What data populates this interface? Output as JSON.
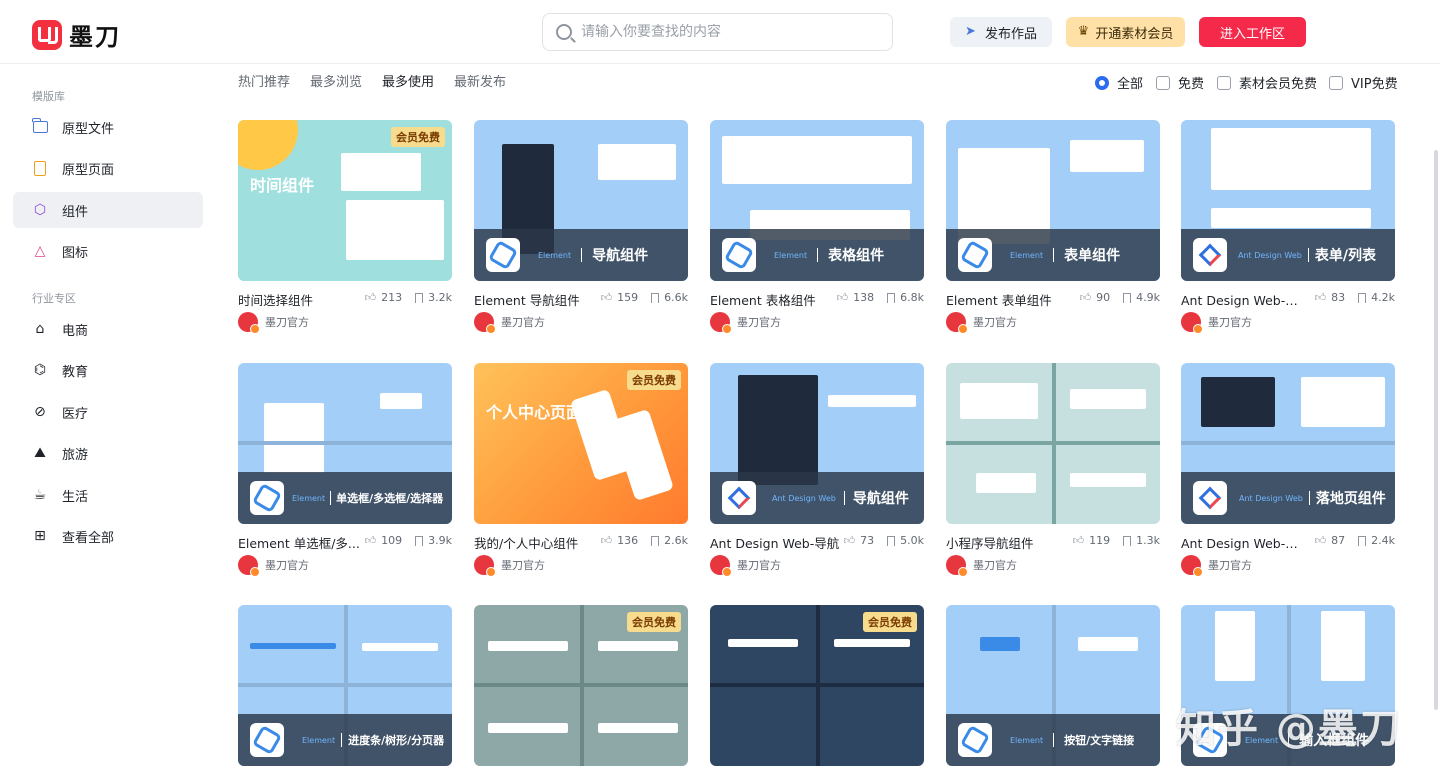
{
  "header": {
    "logo_text": "墨刀",
    "search_placeholder": "请输入你要查找的内容",
    "publish_label": "发布作品",
    "member_label": "开通素材会员",
    "workspace_label": "进入工作区"
  },
  "sidebar": {
    "section1": "模版库",
    "items1": [
      {
        "label": "原型文件",
        "icon": "folder-icon"
      },
      {
        "label": "原型页面",
        "icon": "file-icon"
      },
      {
        "label": "组件",
        "icon": "cube-icon"
      },
      {
        "label": "图标",
        "icon": "shapes-icon"
      }
    ],
    "section2": "行业专区",
    "items2": [
      {
        "label": "电商",
        "icon": "bag-icon"
      },
      {
        "label": "教育",
        "icon": "grad-cap-icon"
      },
      {
        "label": "医疗",
        "icon": "pill-icon"
      },
      {
        "label": "旅游",
        "icon": "mountain-icon"
      },
      {
        "label": "生活",
        "icon": "cup-icon"
      },
      {
        "label": "查看全部",
        "icon": "grid-icon"
      }
    ]
  },
  "tabs": [
    "热门推荐",
    "最多浏览",
    "最多使用",
    "最新发布"
  ],
  "filters": [
    "全部",
    "免费",
    "素材会员免费",
    "VIP免费"
  ],
  "member_badge": "会员免费",
  "author": "墨刀官方",
  "cards": [
    {
      "title": "时间选择组件",
      "likes": "213",
      "saves": "3.2k",
      "brand": "",
      "thumb_title": "时间组件"
    },
    {
      "title": "Element 导航组件",
      "likes": "159",
      "saves": "6.6k",
      "brand": "Element",
      "thumb_title": "导航组件"
    },
    {
      "title": "Element 表格组件",
      "likes": "138",
      "saves": "6.8k",
      "brand": "Element",
      "thumb_title": "表格组件"
    },
    {
      "title": "Element 表单组件",
      "likes": "90",
      "saves": "4.9k",
      "brand": "Element",
      "thumb_title": "表单组件"
    },
    {
      "title": "Ant Design Web-表...",
      "likes": "83",
      "saves": "4.2k",
      "brand": "Ant Design Web",
      "thumb_title": "表单/列表"
    },
    {
      "title": "Element 单选框/多...",
      "likes": "109",
      "saves": "3.9k",
      "brand": "Element",
      "thumb_title": "单选框/多选框/选择器"
    },
    {
      "title": "我的/个人中心组件",
      "likes": "136",
      "saves": "2.6k",
      "brand": "",
      "thumb_title": "个人中心页面"
    },
    {
      "title": "Ant Design Web-导航",
      "likes": "73",
      "saves": "5.0k",
      "brand": "Ant Design Web",
      "thumb_title": "导航组件"
    },
    {
      "title": "小程序导航组件",
      "likes": "119",
      "saves": "1.3k",
      "brand": "",
      "thumb_title": ""
    },
    {
      "title": "Ant Design Web-落...",
      "likes": "87",
      "saves": "2.4k",
      "brand": "Ant Design Web",
      "thumb_title": "落地页组件"
    },
    {
      "title": "",
      "likes": "",
      "saves": "",
      "brand": "Element",
      "thumb_title": "进度条/树形/分页器"
    },
    {
      "title": "",
      "likes": "",
      "saves": "",
      "brand": "",
      "thumb_title": ""
    },
    {
      "title": "",
      "likes": "",
      "saves": "",
      "brand": "",
      "thumb_title": ""
    },
    {
      "title": "",
      "likes": "",
      "saves": "",
      "brand": "Element",
      "thumb_title": "按钮/文字链接"
    },
    {
      "title": "",
      "likes": "",
      "saves": "",
      "brand": "Element",
      "thumb_title": "输入框组件"
    }
  ],
  "watermark": "知乎 @墨刀",
  "colors": {
    "accent": "#f5294a",
    "member": "#ffe1a8",
    "link_blue": "#2c6bef"
  }
}
